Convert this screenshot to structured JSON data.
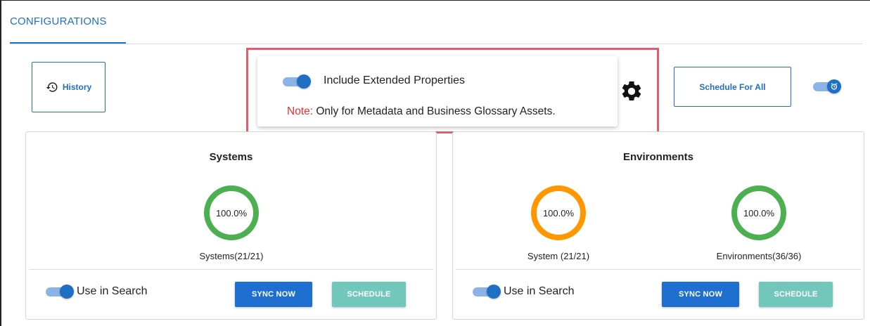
{
  "tabs": [
    {
      "label": "CONFIGURATIONS",
      "active": true
    }
  ],
  "toolbar": {
    "history_label": "History",
    "schedule_all_label": "Schedule For All",
    "schedule_all_toggle": {
      "on": true,
      "icon": "alarm-clock-icon"
    }
  },
  "popover": {
    "toggle_on": true,
    "label": "Include Extended Properties",
    "note_key": "Note:",
    "note_text": " Only for Metadata and Business Glossary Assets.",
    "settings_icon": "gear-icon"
  },
  "cards": [
    {
      "title": "Systems",
      "gauges": [
        {
          "value": "100.0%",
          "label": "Systems(21/21)",
          "percent": 100,
          "color": "#4caf50"
        }
      ],
      "use_in_search_label": "Use in Search",
      "use_in_search_on": true,
      "sync_label": "SYNC NOW",
      "schedule_label": "SCHEDULE"
    },
    {
      "title": "Environments",
      "gauges": [
        {
          "value": "100.0%",
          "label": "System (21/21)",
          "percent": 100,
          "color": "#ff9800"
        },
        {
          "value": "100.0%",
          "label": "Environments(36/36)",
          "percent": 100,
          "color": "#4caf50"
        }
      ],
      "use_in_search_label": "Use in Search",
      "use_in_search_on": true,
      "sync_label": "SYNC NOW",
      "schedule_label": "SCHEDULE"
    }
  ],
  "colors": {
    "accent": "#1f6fc5",
    "highlight": "#d9606e",
    "note": "#e03131",
    "schedule_button": "#71c7ba"
  }
}
